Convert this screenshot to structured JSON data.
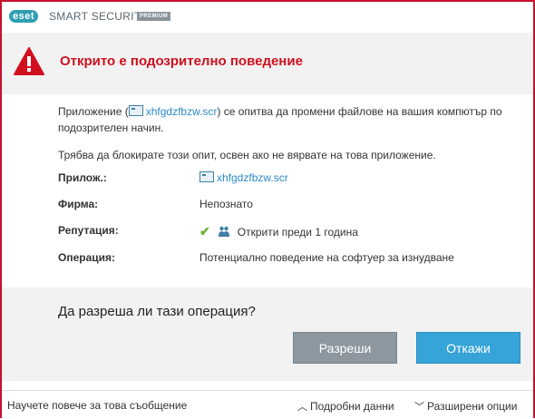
{
  "titlebar": {
    "logo": "eset",
    "product": "SMART SECURITY",
    "edition": "PREMIUM"
  },
  "alert": {
    "heading": "Открито е подозрително поведение",
    "icon": "warning-triangle-icon",
    "accent_color": "#d0101f"
  },
  "message": {
    "p1_prefix": "Приложение (",
    "p1_file": "xhfgdzfbzw.scr",
    "p1_suffix": ") се опитва да промени файлове на вашия компютър по подозрителен начин.",
    "p2": "Трябва да блокирате този опит, освен ако не вярвате на това приложение."
  },
  "details": {
    "app_label": "Прилож.:",
    "app_value": "xhfgdzfbzw.scr",
    "company_label": "Фирма:",
    "company_value": "Непознато",
    "reputation_label": "Репутация:",
    "reputation_value": "Открити преди 1 година",
    "operation_label": "Операция:",
    "operation_value": "Потенциално поведение на софтуер за изнудване"
  },
  "question": "Да разреша ли тази операция?",
  "buttons": {
    "allow": "Разреши",
    "deny": "Откажи"
  },
  "footer": {
    "learn_more": "Научете повече за това съобщение",
    "details": "Подробни данни",
    "advanced": "Разширени опции"
  }
}
